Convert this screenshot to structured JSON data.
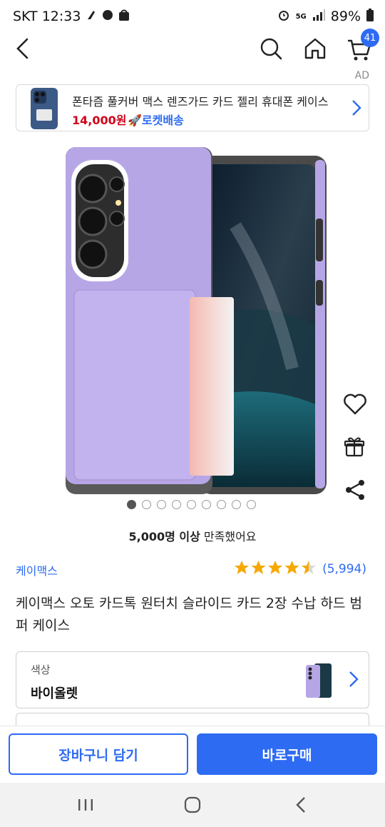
{
  "status_bar": {
    "carrier_time": "SKT 12:33",
    "battery": "89%",
    "network": "5G"
  },
  "header": {
    "back_icon": "back-arrow-icon",
    "search_icon": "search-icon",
    "home_icon": "home-icon",
    "cart_icon": "cart-icon",
    "cart_badge": "41"
  },
  "ad": {
    "label": "AD",
    "title": "폰타즘 풀커버 맥스 렌즈가드 카드 젤리 휴대폰 케이스",
    "price": "14,000원",
    "rocket": "로켓배송"
  },
  "gallery": {
    "dots_total": 9,
    "active_index": 0
  },
  "satisfaction": {
    "bold": "5,000명 이상",
    "rest": " 만족했어요"
  },
  "product": {
    "brand": "케이맥스",
    "rating_value": 4.5,
    "review_count": "(5,994)",
    "title": "케이맥스 오토 카드톡 원터치 슬라이드 카드 2장 수납 하드 범퍼 케이스"
  },
  "option": {
    "label": "색상",
    "value": "바이올렛"
  },
  "actions": {
    "add_to_cart": "장바구니 담기",
    "buy_now": "바로구매"
  },
  "colors": {
    "accent": "#2d6bf3",
    "price_red": "#d0021b",
    "star": "#f5a800",
    "case_violet": "#b7a6e6"
  }
}
